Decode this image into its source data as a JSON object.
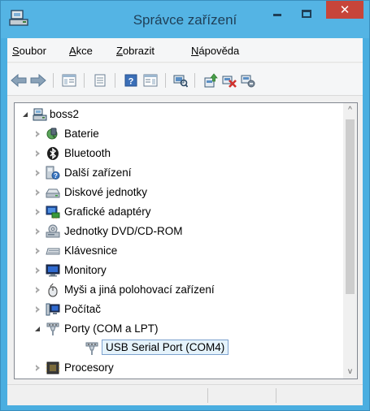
{
  "window": {
    "title": "Správce zařízení",
    "close_glyph": "✕"
  },
  "menu": [
    {
      "access": "S",
      "rest": "oubor"
    },
    {
      "access": "A",
      "rest": "kce"
    },
    {
      "access": "Z",
      "rest": "obrazit"
    },
    {
      "access": "N",
      "rest": "ápověda"
    }
  ],
  "toolbar": {
    "icons": [
      "back-arrow-icon",
      "forward-arrow-icon",
      "show-hide-console-tree-icon",
      "properties-icon",
      "help-icon",
      "action-pane-icon",
      "scan-hardware-icon",
      "update-driver-icon",
      "uninstall-icon",
      "disable-icon"
    ]
  },
  "tree": {
    "root": "boss2",
    "items": [
      {
        "label": "Baterie",
        "icon": "battery-icon"
      },
      {
        "label": "Bluetooth",
        "icon": "bluetooth-icon"
      },
      {
        "label": "Další zařízení",
        "icon": "unknown-device-icon"
      },
      {
        "label": "Diskové jednotky",
        "icon": "disk-drive-icon"
      },
      {
        "label": "Grafické adaptéry",
        "icon": "display-adapter-icon"
      },
      {
        "label": "Jednotky DVD/CD-ROM",
        "icon": "dvd-drive-icon"
      },
      {
        "label": "Klávesnice",
        "icon": "keyboard-icon"
      },
      {
        "label": "Monitory",
        "icon": "monitor-icon"
      },
      {
        "label": "Myši a jiná polohovací zařízení",
        "icon": "mouse-icon"
      },
      {
        "label": "Počítač",
        "icon": "computer-icon"
      },
      {
        "label": "Porty (COM a LPT)",
        "icon": "port-icon"
      },
      {
        "label": "USB Serial Port (COM4)",
        "icon": "port-icon"
      },
      {
        "label": "Procesory",
        "icon": "processor-icon"
      }
    ]
  },
  "scrollbar": {
    "up_glyph": "^",
    "down_glyph": "v"
  }
}
